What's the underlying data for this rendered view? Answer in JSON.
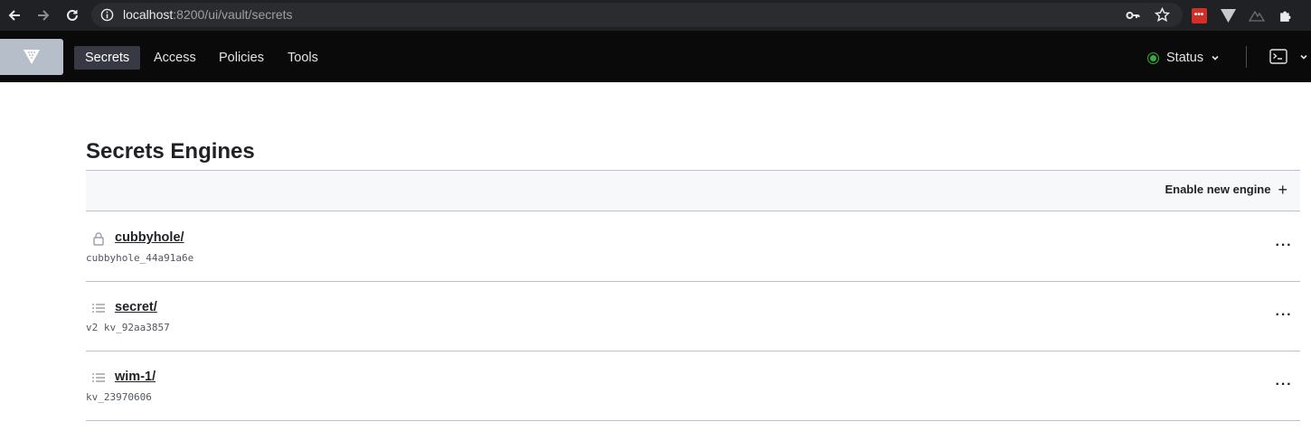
{
  "browser": {
    "url_host": "localhost",
    "url_path": ":8200/ui/vault/secrets"
  },
  "header": {
    "nav": [
      {
        "label": "Secrets",
        "active": true
      },
      {
        "label": "Access",
        "active": false
      },
      {
        "label": "Policies",
        "active": false
      },
      {
        "label": "Tools",
        "active": false
      }
    ],
    "status_label": "Status",
    "status_color": "#2eb039"
  },
  "main": {
    "title": "Secrets Engines",
    "enable_label": "Enable new engine",
    "engines": [
      {
        "name": "cubbyhole/",
        "meta": "cubbyhole_44a91a6e",
        "icon": "lock-icon"
      },
      {
        "name": "secret/",
        "meta": "v2 kv_92aa3857",
        "icon": "list-icon"
      },
      {
        "name": "wim-1/",
        "meta": "kv_23970606",
        "icon": "list-icon"
      }
    ]
  },
  "colors": {
    "header_bg": "#0a0a0a",
    "logo_bg": "#b6bfc9",
    "active_nav_bg": "#373a42"
  }
}
